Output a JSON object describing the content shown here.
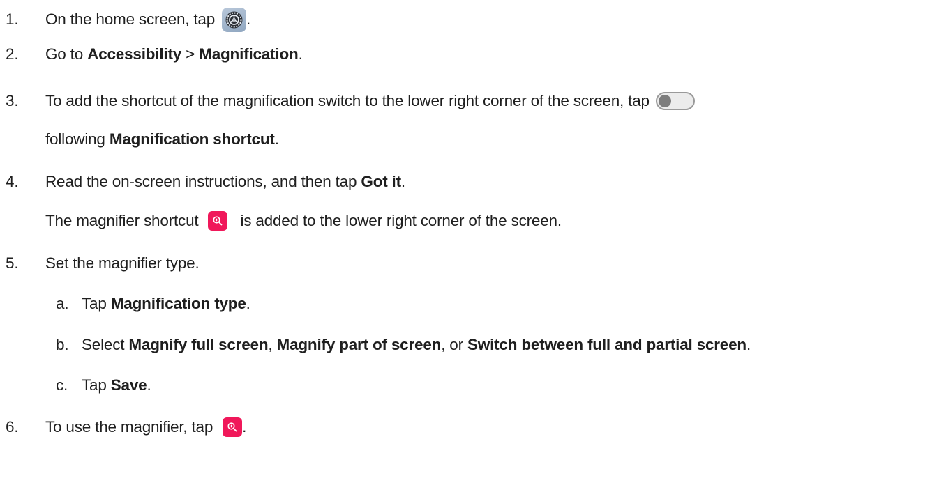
{
  "steps": [
    {
      "num": "1.",
      "text_before": "On the home screen, tap",
      "icon": "settings-gear-icon",
      "text_after": "."
    },
    {
      "num": "2.",
      "text_before": "Go to ",
      "bold1": "Accessibility",
      "sep": " > ",
      "bold2": "Magnification",
      "text_after": "."
    },
    {
      "num": "3.",
      "text_before": "To add the shortcut of the magnification switch to the lower right corner of the screen, tap",
      "icon": "toggle-switch-off-icon",
      "line2_before": "following ",
      "line2_bold": "Magnification shortcut",
      "line2_after": "."
    },
    {
      "num": "4.",
      "text_before": "Read the on-screen instructions, and then tap ",
      "bold1": "Got it",
      "text_after": ".",
      "note_before": "The magnifier shortcut",
      "note_icon": "magnifier-shortcut-icon",
      "note_after": "is added to the lower right corner of the screen."
    },
    {
      "num": "5.",
      "text": "Set the magnifier type.",
      "substeps": [
        {
          "num": "a.",
          "text_before": "Tap ",
          "bold1": "Magnification type",
          "text_after": "."
        },
        {
          "num": "b.",
          "text_before": "Select ",
          "bold1": "Magnify full screen",
          "sep1": ", ",
          "bold2": "Magnify part of screen",
          "sep2": ", or ",
          "bold3": "Switch between full and partial screen",
          "text_after": "."
        },
        {
          "num": "c.",
          "text_before": "Tap ",
          "bold1": "Save",
          "text_after": "."
        }
      ]
    },
    {
      "num": "6.",
      "text_before": "To use the magnifier, tap",
      "icon": "magnifier-shortcut-icon",
      "text_after": "."
    }
  ],
  "colors": {
    "magnifier_accent": "#f0185a",
    "settings_icon_bg": "#a4b6cc",
    "toggle_knob": "#7d7d7d"
  }
}
